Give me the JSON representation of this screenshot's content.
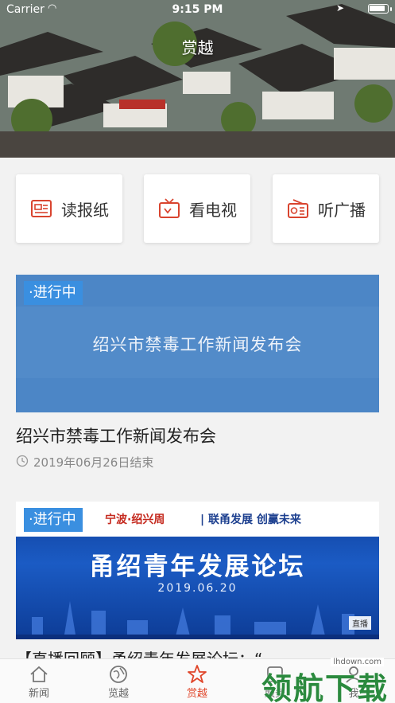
{
  "status_bar": {
    "carrier": "Carrier",
    "time": "9:15 PM"
  },
  "header": {
    "title": "赏越"
  },
  "quick_links": [
    {
      "label": "读报纸",
      "icon": "newspaper-icon"
    },
    {
      "label": "看电视",
      "icon": "tv-icon"
    },
    {
      "label": "听广播",
      "icon": "radio-icon"
    }
  ],
  "feed": [
    {
      "badge": "·进行中",
      "banner_text": "绍兴市禁毒工作新闻发布会",
      "title": "绍兴市禁毒工作新闻发布会",
      "meta": "2019年06月26日结束"
    },
    {
      "badge": "·进行中",
      "banner_brand": "宁波·绍兴周",
      "banner_slogan": "| 联甬发展 创赢未来",
      "banner_heading": "甬绍青年发展论坛",
      "banner_date": "2019.06.20",
      "banner_live": "直播",
      "title": "【直播回顾】甬绍青年发展论坛：“"
    }
  ],
  "tabbar": {
    "items": [
      {
        "label": "新闻",
        "icon": "home-icon"
      },
      {
        "label": "览越",
        "icon": "globe-icon"
      },
      {
        "label": "赏越",
        "icon": "star-icon",
        "active": true
      },
      {
        "label": "服务",
        "icon": "service-icon"
      },
      {
        "label": "我",
        "icon": "user-icon"
      }
    ]
  },
  "watermark": {
    "text": "领航下载",
    "url": "lhdown.com"
  },
  "colors": {
    "accent": "#e0462a",
    "badge": "#3a8fe0",
    "icon_red": "#d9442f"
  }
}
